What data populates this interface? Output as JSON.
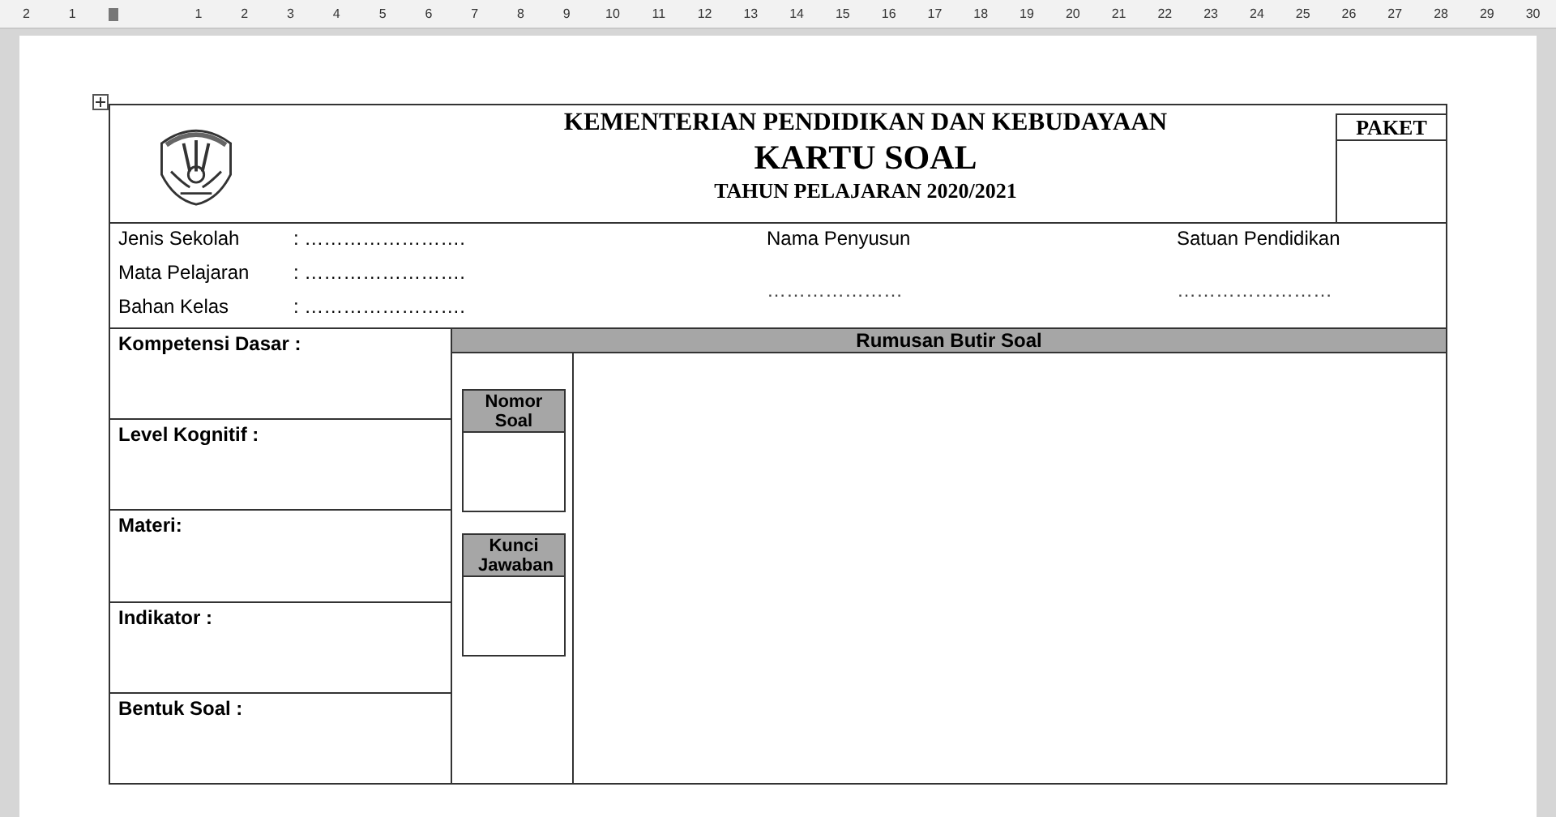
{
  "ruler": {
    "left_labels": [
      "2",
      "1"
    ],
    "right_labels": [
      "1",
      "2",
      "3",
      "4",
      "5",
      "6",
      "7",
      "8",
      "9",
      "10",
      "11",
      "12",
      "13",
      "14",
      "15",
      "16",
      "17",
      "18",
      "19",
      "20",
      "21",
      "22",
      "23",
      "24",
      "25",
      "26",
      "27",
      "28",
      "29",
      "30"
    ]
  },
  "header": {
    "ministry": "KEMENTERIAN PENDIDIKAN DAN KEBUDAYAAN",
    "title": "KARTU SOAL",
    "year": "TAHUN PELAJARAN 2020/2021",
    "paket_label": "PAKET"
  },
  "info": {
    "fields": [
      {
        "label": "Jenis Sekolah",
        "value": ": ……………………."
      },
      {
        "label": "Mata Pelajaran",
        "value": ": ……………………."
      },
      {
        "label": "Bahan Kelas",
        "value": ": ……………………."
      }
    ],
    "columns": [
      {
        "label": "Nama Penyusun",
        "value": "…………………"
      },
      {
        "label": "Satuan Pendidikan",
        "value": "……………………"
      }
    ]
  },
  "left_sections": [
    "Kompetensi Dasar :",
    "Level Kognitif :",
    "Materi:",
    "Indikator :",
    "Bentuk Soal :"
  ],
  "rumusan": {
    "title": "Rumusan Butir Soal",
    "boxes": [
      "Nomor Soal",
      "Kunci Jawaban"
    ]
  }
}
